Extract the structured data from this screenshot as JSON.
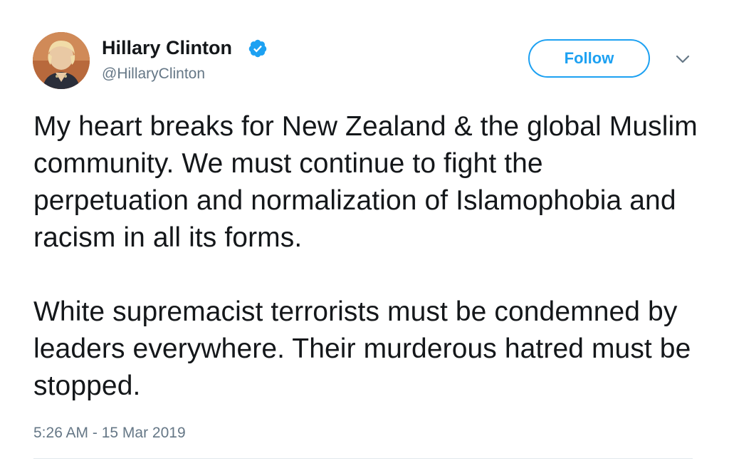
{
  "tweet": {
    "author": {
      "name": "Hillary Clinton",
      "handle": "@HillaryClinton",
      "verified": true
    },
    "follow_label": "Follow",
    "paragraphs": [
      "My heart breaks for New Zealand & the global Muslim community. We must continue to fight the perpetuation and normalization of Islamophobia and racism in all its forms.",
      "White supremacist terrorists must be condemned by leaders everywhere. Their murderous hatred must be stopped."
    ],
    "timestamp": "5:26 AM - 15 Mar 2019"
  },
  "icons": {
    "verified": "verified-check-icon",
    "menu": "chevron-down-icon"
  },
  "colors": {
    "accent": "#1da1f2",
    "text_primary": "#14171a",
    "text_secondary": "#657786",
    "divider": "#e1e8ed"
  }
}
